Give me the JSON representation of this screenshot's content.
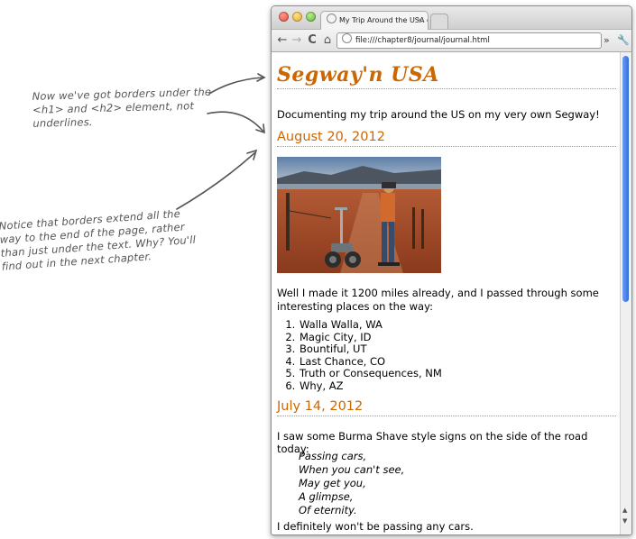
{
  "annotations": {
    "note1": "Now we've got borders under the <h1> and <h2> element, not underlines.",
    "note2": "Notice that borders extend all the way to the end of the page, rather than just under the text. Why? You'll find out in the next chapter."
  },
  "browser": {
    "tab_title": "My Trip Around the USA on a Segway",
    "url": "file:///chapter8/journal/journal.html",
    "tab_close_glyph": "×",
    "nav": {
      "back": "←",
      "forward": "→",
      "reload": "C",
      "home": "⌂"
    },
    "more_glyph": "»",
    "wrench_glyph": "🔧"
  },
  "page": {
    "title": "Segway'n USA",
    "intro": "Documenting my trip around the US on my very own Segway!",
    "entries": [
      {
        "date": "August 20, 2012",
        "paragraph": "Well I made it 1200 miles already, and I passed through some interesting places on the way:",
        "places": [
          "Walla Walla, WA",
          "Magic City, ID",
          "Bountiful, UT",
          "Last Chance, CO",
          "Truth or Consequences, NM",
          "Why, AZ"
        ]
      },
      {
        "date": "July 14, 2012",
        "paragraph": "I saw some Burma Shave style signs on the side of the road today:",
        "poem": [
          "Passing cars,",
          "When you can't see,",
          "May get you,",
          "A glimpse,",
          "Of eternity."
        ],
        "closing": "I definitely won't be passing any cars."
      }
    ]
  },
  "colors": {
    "heading": "#cc6600",
    "scroll_thumb": "#2f6fe0"
  }
}
